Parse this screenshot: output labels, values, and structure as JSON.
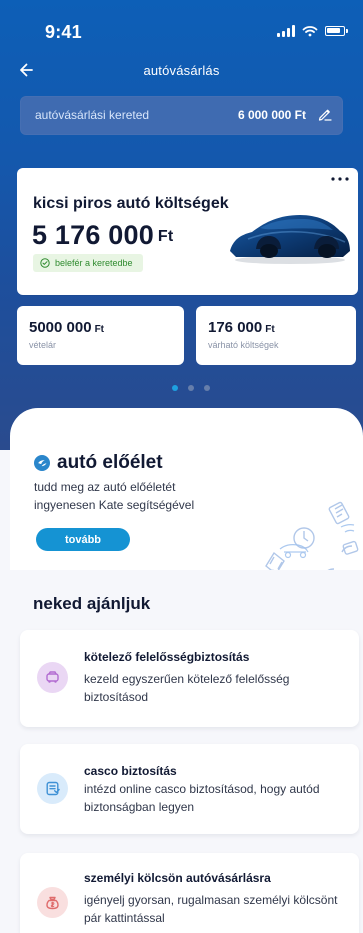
{
  "status": {
    "time": "9:41"
  },
  "header": {
    "title": "autóvásárlás",
    "back_icon": "back-arrow-icon"
  },
  "budget": {
    "label": "autóvásárlási kereted",
    "value": "6 000 000 Ft",
    "edit_icon": "pencil-icon"
  },
  "summary": {
    "title": "kicsi piros autó költségek",
    "amount": "5 176 000",
    "currency": "Ft",
    "badge": "belefér a keretedbe",
    "more_icon": "more-icon",
    "car_icon": "covered-car-icon"
  },
  "metrics": [
    {
      "value": "5000 000",
      "currency": "Ft",
      "label": "vételár"
    },
    {
      "value": "176 000",
      "currency": "Ft",
      "label": "várható költségek"
    }
  ],
  "pager": {
    "count": 3,
    "active_index": 0
  },
  "history": {
    "title": "autó előélet",
    "description": "tudd meg az autó előéletét ingyenesen Kate segítségével",
    "button": "tovább",
    "logo_icon": "autotrack-icon"
  },
  "recommendations": {
    "heading": "neked ajánljuk",
    "items": [
      {
        "title": "kötelező felelősségbiztosítás",
        "description": "kezeld egyszerűen kötelező felelősség biztosításod",
        "icon": "car-icon",
        "accent": "#b26cd1"
      },
      {
        "title": "casco biztosítás",
        "description": "intézd online casco biztosításod, hogy autód biztonságban legyen",
        "icon": "casco-document-icon",
        "accent": "#3f91d5"
      },
      {
        "title": "személyi kölcsön autóvásárlásra",
        "description": "igényelj gyorsan, rugalmasan személyi kölcsönt pár kattintással",
        "icon": "money-bag-icon",
        "accent": "#df6b6b"
      }
    ]
  },
  "colors": {
    "hero_top": "#0d5fb7",
    "hero_bottom": "#2a4b8e",
    "primary_button": "#1593d3",
    "success_bg": "#e8f5e3",
    "success_text": "#2f8b2f"
  }
}
